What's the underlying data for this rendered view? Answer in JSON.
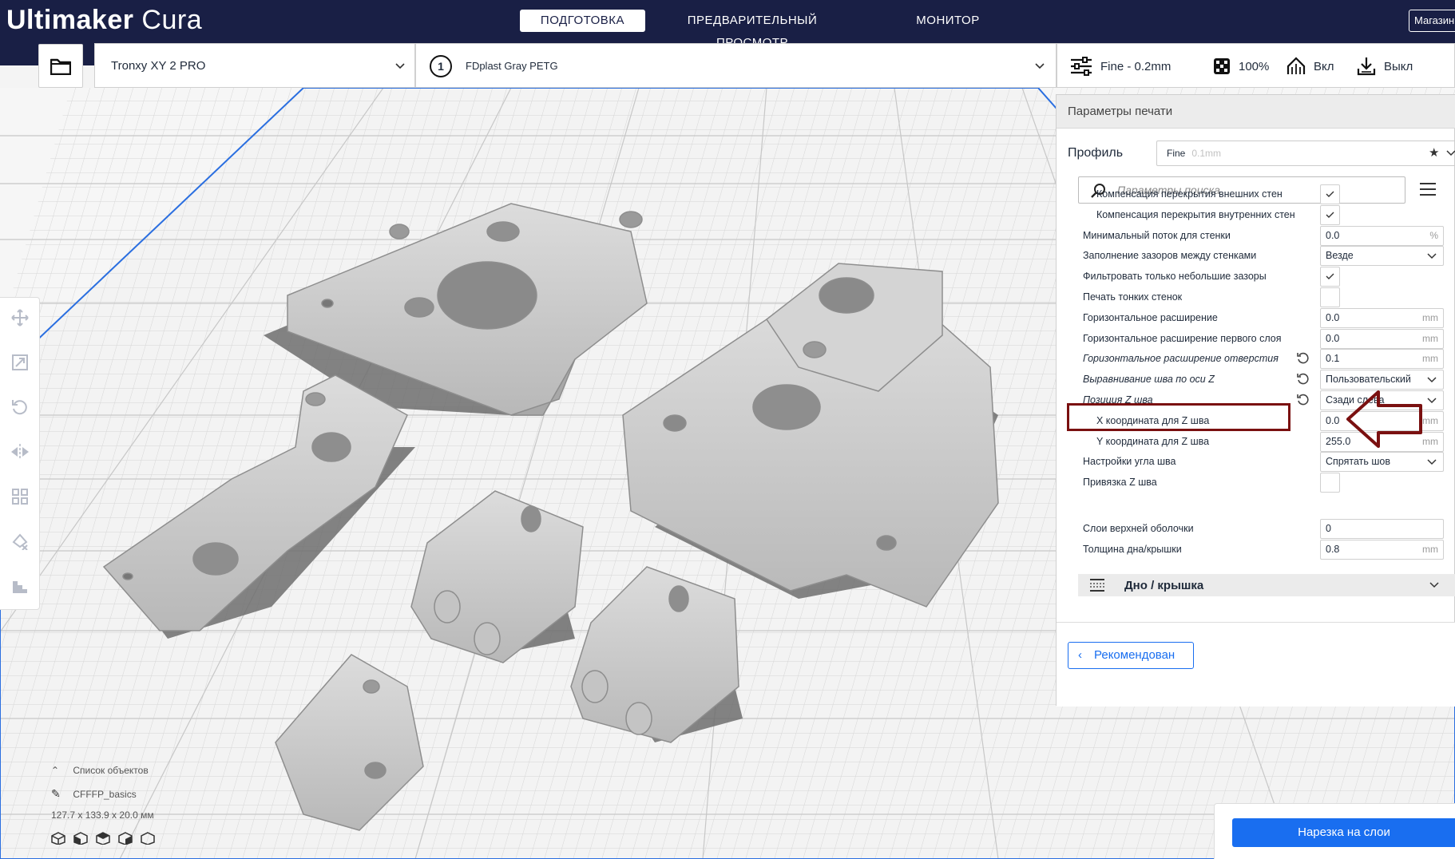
{
  "app": {
    "brand": "Ultimaker",
    "product": "Cura"
  },
  "stages": [
    {
      "label": "ПОДГОТОВКА",
      "active": true
    },
    {
      "label": "ПРЕДВАРИТЕЛЬНЫЙ ПРОСМОТР",
      "active": false
    },
    {
      "label": "МОНИТОР",
      "active": false
    }
  ],
  "marketplace_label": "Магазин",
  "machine": {
    "name": "Tronxy XY 2 PRO"
  },
  "extruder": {
    "index": "1",
    "material": "FDplast Gray PETG"
  },
  "print_setup_summary": {
    "profile": "Fine - 0.2mm",
    "infill": "100%",
    "support": "Вкл",
    "adhesion": "Выкл"
  },
  "panel": {
    "title": "Параметры печати",
    "profile_label": "Профиль",
    "profile_value": "Fine",
    "profile_sub": "0.1mm",
    "search_placeholder": "Параметры поиска",
    "settings": [
      {
        "label": "Компенсация перекрытия внешних стен",
        "type": "check",
        "checked": true,
        "indent": 2
      },
      {
        "label": "Компенсация перекрытия внутренних стен",
        "type": "check",
        "checked": true,
        "indent": 2
      },
      {
        "label": "Минимальный поток для стенки",
        "type": "field",
        "value": "0.0",
        "unit": "%",
        "indent": 1
      },
      {
        "label": "Заполнение зазоров между стенками",
        "type": "combo",
        "value": "Везде",
        "indent": 1
      },
      {
        "label": "Фильтровать только небольшие зазоры",
        "type": "check",
        "checked": true,
        "indent": 1
      },
      {
        "label": "Печать тонких стенок",
        "type": "check",
        "checked": false,
        "indent": 1
      },
      {
        "label": "Горизонтальное расширение",
        "type": "field",
        "value": "0.0",
        "unit": "mm",
        "indent": 1
      },
      {
        "label": "Горизонтальное расширение первого слоя",
        "type": "field",
        "value": "0.0",
        "unit": "mm",
        "indent": 1
      },
      {
        "label": "Горизонтальное расширение отверстия",
        "type": "field",
        "value": "0.1",
        "unit": "mm",
        "indent": 1,
        "modified": true
      },
      {
        "label": "Выравнивание шва по оси Z",
        "type": "combo",
        "value": "Пользовательский",
        "indent": 1,
        "modified": true
      },
      {
        "label": "Позиция Z шва",
        "type": "combo",
        "value": "Сзади слева",
        "indent": 1,
        "modified": true
      },
      {
        "label": "X координата для Z шва",
        "type": "field",
        "value": "0.0",
        "unit": "mm",
        "indent": 2
      },
      {
        "label": "Y координата для Z шва",
        "type": "field",
        "value": "255.0",
        "unit": "mm",
        "indent": 2
      },
      {
        "label": "Настройки угла шва",
        "type": "combo",
        "value": "Спрятать шов",
        "indent": 1
      },
      {
        "label": "Привязка Z шва",
        "type": "check",
        "checked": false,
        "indent": 1
      }
    ],
    "category": {
      "label": "Дно / крышка"
    },
    "category_settings": [
      {
        "label": "Слои верхней оболочки",
        "type": "field",
        "value": "0",
        "unit": "",
        "indent": 1
      },
      {
        "label": "Толщина дна/крышки",
        "type": "field",
        "value": "0.8",
        "unit": "mm",
        "indent": 1
      }
    ],
    "recommended_label": "Рекомендован"
  },
  "object_list": {
    "header": "Список объектов",
    "name": "CFFFP_basics",
    "dimensions": "127.7 x 133.9 x 20.0 мм"
  },
  "slice_label": "Нарезка на слои",
  "colors": {
    "topbar": "#191f45",
    "accent": "#196ef0",
    "annotation": "#7a1010",
    "model": "#c8c8c8"
  },
  "icons": {
    "open": "folder-icon",
    "tools": [
      "move-icon",
      "scale-icon",
      "rotate-icon",
      "mirror-icon",
      "arrange-icon",
      "support-blocker-icon",
      "layers-icon"
    ],
    "views": [
      "view-3d-icon",
      "view-front-icon",
      "view-top-icon",
      "view-left-icon",
      "view-right-icon"
    ]
  }
}
